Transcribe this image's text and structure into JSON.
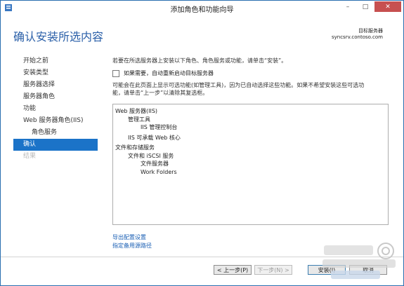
{
  "window": {
    "title": "添加角色和功能向导",
    "controls": {
      "minimize": "–",
      "maximize": "□",
      "close": "✕"
    }
  },
  "page": {
    "heading": "确认安装所选内容",
    "destination_label": "目标服务器",
    "destination_server": "syncsrv.contoso.com"
  },
  "nav": {
    "items": [
      {
        "label": "开始之前",
        "state": "normal"
      },
      {
        "label": "安装类型",
        "state": "normal"
      },
      {
        "label": "服务器选择",
        "state": "normal"
      },
      {
        "label": "服务器角色",
        "state": "normal"
      },
      {
        "label": "功能",
        "state": "normal"
      },
      {
        "label": "Web 服务器角色(IIS)",
        "state": "normal"
      },
      {
        "label": "角色服务",
        "state": "sub"
      },
      {
        "label": "确认",
        "state": "active"
      },
      {
        "label": "结果",
        "state": "disabled"
      }
    ]
  },
  "content": {
    "instruction": "若要在所选服务器上安装以下角色、角色服务或功能，请单击“安装”。",
    "restart_checkbox": {
      "label": "如果需要，自动重新启动目标服务器",
      "checked": false
    },
    "info_line1": "可能会在此页面上显示可选功能(如管理工具)，因为已自动选择这些功能。如果不希望安装这些可选功",
    "info_line2": "能，请单击“上一步”以清除其复选框。",
    "features": [
      {
        "text": "Web 服务器(IIS)",
        "level": 0
      },
      {
        "text": "管理工具",
        "level": 1
      },
      {
        "text": "IIS 管理控制台",
        "level": 2
      },
      {
        "text": "IIS 可承载 Web 核心",
        "level": 1
      },
      {
        "text": "文件和存储服务",
        "level": 0
      },
      {
        "text": "文件和 iSCSI 服务",
        "level": 1
      },
      {
        "text": "文件服务器",
        "level": 2
      },
      {
        "text": "Work Folders",
        "level": 2
      }
    ],
    "export_link": "导出配置设置",
    "alt_source_link": "指定备用源路径"
  },
  "buttons": {
    "prev": "< 上一步(P)",
    "next": "下一步(N) >",
    "install": "安装(I)",
    "cancel": "取消"
  },
  "colors": {
    "accent": "#1b73c8",
    "heading": "#2a5fa8",
    "link": "#1a5fb4"
  }
}
